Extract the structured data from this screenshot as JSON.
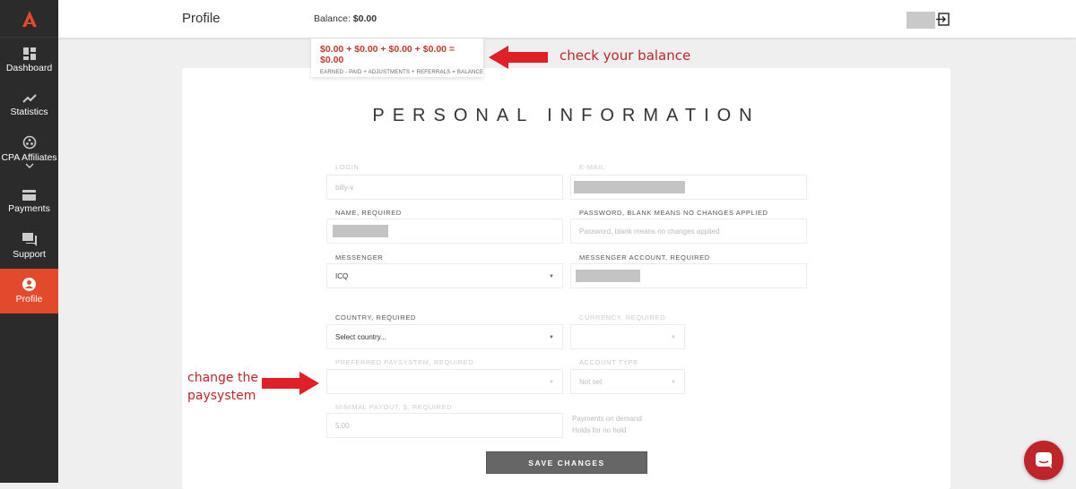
{
  "sidebar": {
    "items": [
      {
        "label": "Dashboard",
        "icon": "dashboard-icon"
      },
      {
        "label": "Statistics",
        "icon": "trending-up-icon"
      },
      {
        "label": "CPA Affiliates",
        "icon": "affiliates-icon"
      },
      {
        "label": "Payments",
        "icon": "credit-card-icon"
      },
      {
        "label": "Support",
        "icon": "chat-bubbles-icon"
      },
      {
        "label": "Profile",
        "icon": "user-icon",
        "active": true
      }
    ]
  },
  "header": {
    "title": "Profile",
    "balance_label": "Balance:",
    "balance_value": "$0.00"
  },
  "balance_popup": {
    "sum": "$0.00 + $0.00 + $0.00 + $0.00 = $0.00",
    "legend": "EARNED - PAID + ADJUSTMENTS + REFERRALS = BALANCE"
  },
  "form": {
    "heading": "PERSONAL INFORMATION",
    "login": {
      "label": "LOGIN",
      "value": "billy-v"
    },
    "email": {
      "label": "E-MAIL"
    },
    "name": {
      "label": "NAME, REQUIRED"
    },
    "password": {
      "label": "PASSWORD, BLANK MEANS NO CHANGES APPLIED",
      "placeholder": "Password, blank means no changes applied"
    },
    "messenger": {
      "label": "MESSENGER",
      "value": "ICQ"
    },
    "messenger_account": {
      "label": "MESSENGER ACCOUNT, REQUIRED"
    },
    "country": {
      "label": "COUNTRY, REQUIRED",
      "value": "Select country..."
    },
    "currency": {
      "label": "CURRENCY, REQUIRED",
      "value": ""
    },
    "paysystem": {
      "label": "PREFERRED PAYSYSTEM, REQUIRED",
      "value": ""
    },
    "account_type": {
      "label": "ACCOUNT TYPE",
      "value": "Not set"
    },
    "minimal_payout": {
      "label": "MINIMAL PAYOUT, $, REQUIRED",
      "value": "5.00"
    },
    "notes": [
      "Payments on demand",
      "Holds for no hold"
    ],
    "save_label": "SAVE CHANGES"
  },
  "annotations": {
    "balance": "check your balance",
    "paysystem": "change the paysystem"
  },
  "colors": {
    "accent": "#e24a2b",
    "sidebar": "#2b2b2b",
    "annotation": "#c0242b"
  }
}
